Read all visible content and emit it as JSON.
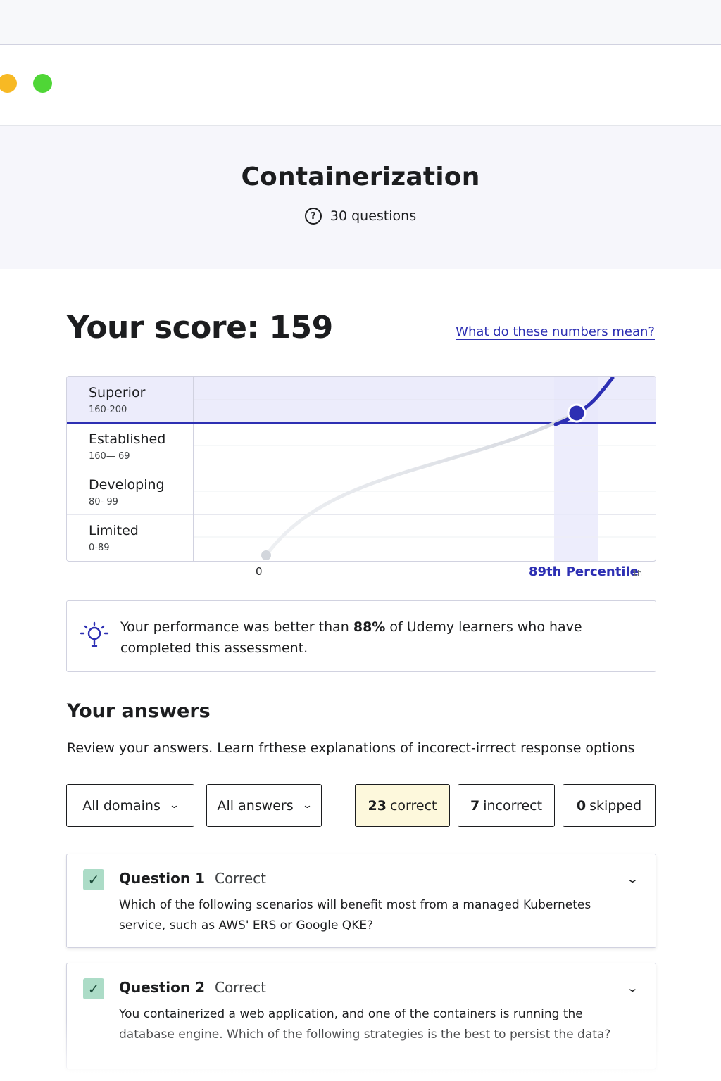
{
  "page": {
    "title": "Containerization",
    "question_count": "30 questions",
    "question_icon": "?"
  },
  "score": {
    "label": "Your score: 159",
    "help_link": "What do these numbers mean?"
  },
  "chart_data": {
    "type": "line",
    "bands": [
      {
        "label": "Superior",
        "range": "160-200",
        "highlighted": true
      },
      {
        "label": "Established",
        "range": "160— 69"
      },
      {
        "label": "Developing",
        "range": "80- 99"
      },
      {
        "label": "Limited",
        "range": "0-89"
      }
    ],
    "x_axis_start_label": "0",
    "percentile_label": "89th Percentile",
    "percentile_sub": "1h",
    "marker_percentile": 89,
    "accent_color": "#2d2fb3",
    "highlight_color": "#e8e8fb"
  },
  "insight": {
    "icon": "lightbulb-icon",
    "text_before": "Your performance was better than ",
    "highlight": "88%",
    "text_after": " of Udemy learners who have completed this assessment."
  },
  "answers": {
    "title": "Your answers",
    "description": "Review your answers. Learn frthese explanations of incorect-irrrect response options",
    "filter_domains": "All domains",
    "filter_answers": "All answers",
    "correct_count": "23",
    "correct_label": "correct",
    "incorrect_count": "7",
    "incorrect_label": "incorrect",
    "skipped_count": "0",
    "skipped_label": "skipped"
  },
  "questions": [
    {
      "number": "Question 1",
      "status": "Correct",
      "text": "Which of the following scenarios will benefit most from a managed Kubernetes service, such as AWS' ERS or Google QKE?"
    },
    {
      "number": "Question 2",
      "status": "Correct",
      "text": "You containerized a web application, and one of the containers is running the database engine. Which of the following strategies is the best to persist the data?"
    }
  ]
}
